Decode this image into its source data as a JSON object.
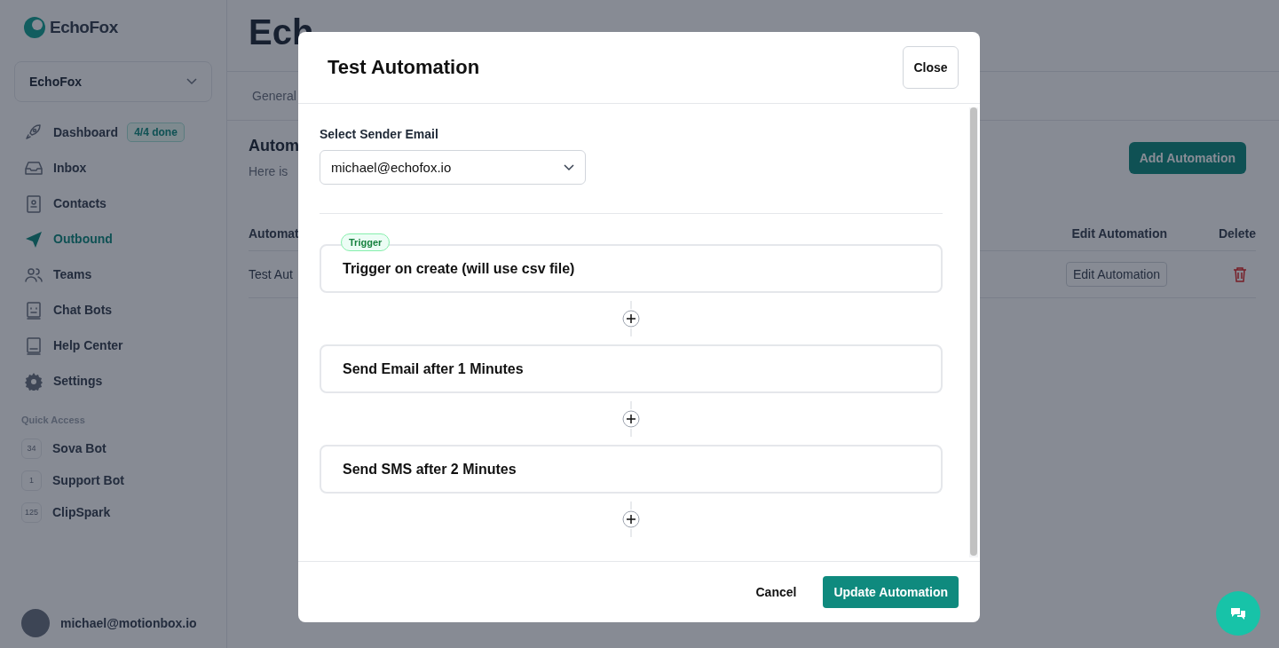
{
  "sidebar": {
    "logo": "EchoFox",
    "workspace": "EchoFox",
    "nav": [
      {
        "label": "Dashboard",
        "badge": "4/4 done",
        "selected": false
      },
      {
        "label": "Inbox",
        "selected": false
      },
      {
        "label": "Contacts",
        "selected": false
      },
      {
        "label": "Outbound",
        "selected": true
      },
      {
        "label": "Teams",
        "selected": false
      },
      {
        "label": "Chat Bots",
        "selected": false
      },
      {
        "label": "Help Center",
        "selected": false
      },
      {
        "label": "Settings",
        "selected": false
      }
    ],
    "quick_access_title": "Quick Access",
    "quick_access": [
      {
        "count": "34",
        "label": "Sova Bot"
      },
      {
        "count": "1",
        "label": "Support Bot"
      },
      {
        "count": "125",
        "label": "ClipSpark"
      }
    ],
    "user": "michael@motionbox.io"
  },
  "main": {
    "title": "Ech",
    "tab": "General",
    "section_title": "Autom",
    "section_subtitle": "Here is",
    "add_button": "Add Automation",
    "table": {
      "columns": [
        "Automat",
        "Edit Automation",
        "Delete"
      ],
      "rows": [
        {
          "name": "Test Aut",
          "edit": "Edit Automation"
        }
      ]
    }
  },
  "modal": {
    "title": "Test Automation",
    "close": "Close",
    "sender_label": "Select Sender Email",
    "sender_value": "michael@echofox.io",
    "steps": [
      {
        "badge": "Trigger",
        "label": "Trigger on create (will use csv file)"
      },
      {
        "label": "Send Email after 1 Minutes"
      },
      {
        "label": "Send SMS after 2 Minutes"
      }
    ],
    "cancel": "Cancel",
    "submit": "Update Automation"
  }
}
